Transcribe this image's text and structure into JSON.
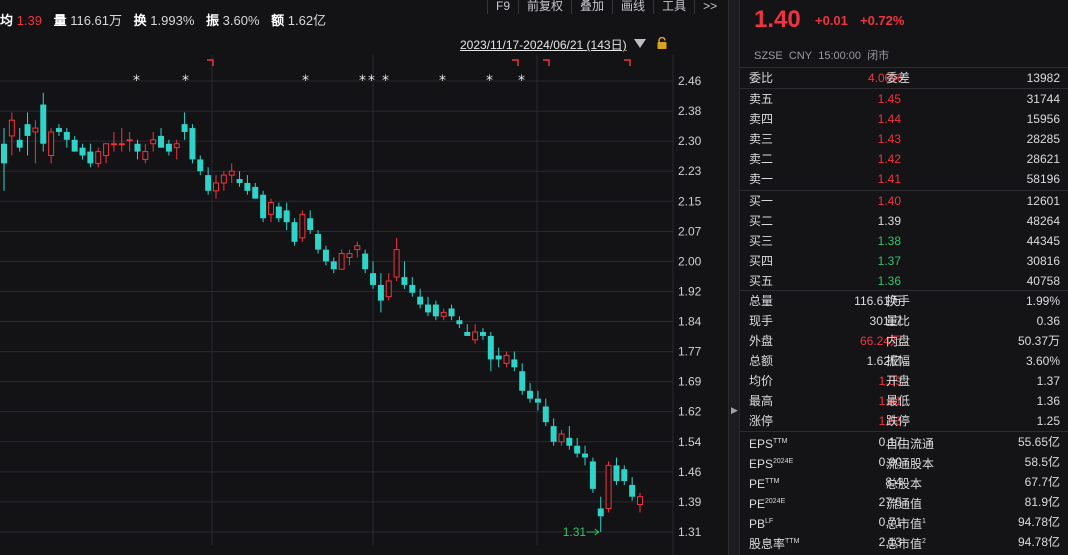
{
  "header": {
    "avg_label": "均",
    "avg_value": "1.39",
    "vol_label": "量",
    "vol_value": "116.61万",
    "turn_label": "换",
    "turn_value": "1.993%",
    "amp_label": "振",
    "amp_value": "3.60%",
    "amt_label": "额",
    "amt_value": "1.62亿"
  },
  "toolbar": [
    "F9",
    "前复权",
    "叠加",
    "画线",
    "工具",
    ">>"
  ],
  "date_range": "2023/11/17-2024/06/21 (143日)",
  "axis_labels": [
    "2.46",
    "2.38",
    "2.30",
    "2.23",
    "2.15",
    "2.07",
    "2.00",
    "1.92",
    "1.84",
    "1.77",
    "1.69",
    "1.62",
    "1.54",
    "1.46",
    "1.39",
    "1.31"
  ],
  "low_marker": "1.31",
  "colors": {
    "up": "#f0333f",
    "down": "#2fd3c8",
    "grid": "#2a2a2f"
  },
  "quote": {
    "price": "1.40",
    "change": "+0.01",
    "change_pct": "+0.72%",
    "exchange": "SZSE",
    "currency": "CNY",
    "time": "15:00:00",
    "status": "闭市"
  },
  "weibi": {
    "label1": "委比",
    "value1": "4.00%",
    "label2": "委差",
    "value2": "13982"
  },
  "asks": [
    {
      "label": "卖五",
      "price": "1.45",
      "volume": "31744"
    },
    {
      "label": "卖四",
      "price": "1.44",
      "volume": "15956"
    },
    {
      "label": "卖三",
      "price": "1.43",
      "volume": "28285"
    },
    {
      "label": "卖二",
      "price": "1.42",
      "volume": "28621"
    },
    {
      "label": "卖一",
      "price": "1.41",
      "volume": "58196"
    }
  ],
  "bids": [
    {
      "label": "买一",
      "price": "1.40",
      "volume": "12601"
    },
    {
      "label": "买二",
      "price": "1.39",
      "volume": "48264"
    },
    {
      "label": "买三",
      "price": "1.38",
      "volume": "44345"
    },
    {
      "label": "买四",
      "price": "1.37",
      "volume": "30816"
    },
    {
      "label": "买五",
      "price": "1.36",
      "volume": "40758"
    }
  ],
  "stats": [
    {
      "l1": "总量",
      "v1": "116.61万",
      "l2": "换手",
      "v2": "1.99%"
    },
    {
      "l1": "现手",
      "v1": "30117",
      "l2": "量比",
      "v2": "0.36"
    },
    {
      "l1": "外盘",
      "v1": "66.24万",
      "l2": "内盘",
      "v2": "50.37万"
    },
    {
      "l1": "总额",
      "v1": "1.62亿",
      "l2": "振幅",
      "v2": "3.60%"
    },
    {
      "l1": "均价",
      "v1": "1.39",
      "l2": "开盘",
      "v2": "1.37"
    },
    {
      "l1": "最高",
      "v1": "1.41",
      "l2": "最低",
      "v2": "1.36"
    },
    {
      "l1": "涨停",
      "v1": "1.53",
      "l2": "跌停",
      "v2": "1.25"
    }
  ],
  "fundamentals": [
    {
      "l1": "EPS",
      "s1": "TTM",
      "v1": "0.17",
      "l2": "自由流通",
      "s2": "",
      "v2": "55.65亿"
    },
    {
      "l1": "EPS",
      "s1": "2024E",
      "v1": "0.00",
      "l2": "流通股本",
      "s2": "",
      "v2": "58.5亿"
    },
    {
      "l1": "PE",
      "s1": "TTM",
      "v1": "8.4",
      "l2": "总股本",
      "s2": "",
      "v2": "67.7亿"
    },
    {
      "l1": "PE",
      "s1": "2024E",
      "v1": "27.5",
      "l2": "流通值",
      "s2": "",
      "v2": "81.9亿"
    },
    {
      "l1": "PB",
      "s1": "LF",
      "v1": "0.71",
      "l2": "总市值",
      "s2": "1",
      "v2": "94.78亿"
    },
    {
      "l1": "股息率",
      "s1": "TTM",
      "v1": "2.13",
      "l2": "总市值",
      "s2": "2",
      "v2": "94.78亿"
    }
  ],
  "candles": [
    [
      2.3,
      2.34,
      2.18,
      2.25
    ],
    [
      2.32,
      2.38,
      2.27,
      2.36
    ],
    [
      2.31,
      2.34,
      2.28,
      2.29
    ],
    [
      2.35,
      2.38,
      2.27,
      2.32
    ],
    [
      2.33,
      2.36,
      2.25,
      2.34
    ],
    [
      2.4,
      2.43,
      2.28,
      2.3
    ],
    [
      2.27,
      2.34,
      2.25,
      2.33
    ],
    [
      2.34,
      2.35,
      2.32,
      2.33
    ],
    [
      2.33,
      2.34,
      2.29,
      2.31
    ],
    [
      2.31,
      2.32,
      2.28,
      2.28
    ],
    [
      2.29,
      2.3,
      2.26,
      2.27
    ],
    [
      2.28,
      2.3,
      2.24,
      2.25
    ],
    [
      2.25,
      2.29,
      2.24,
      2.28
    ],
    [
      2.27,
      2.3,
      2.25,
      2.3
    ],
    [
      2.3,
      2.33,
      2.28,
      2.3
    ],
    [
      2.3,
      2.34,
      2.28,
      2.3
    ],
    [
      2.31,
      2.33,
      2.28,
      2.31
    ],
    [
      2.3,
      2.31,
      2.26,
      2.28
    ],
    [
      2.26,
      2.3,
      2.25,
      2.28
    ],
    [
      2.3,
      2.33,
      2.28,
      2.31
    ],
    [
      2.32,
      2.34,
      2.29,
      2.29
    ],
    [
      2.3,
      2.31,
      2.27,
      2.28
    ],
    [
      2.29,
      2.31,
      2.26,
      2.3
    ],
    [
      2.35,
      2.38,
      2.31,
      2.33
    ],
    [
      2.34,
      2.35,
      2.25,
      2.26
    ],
    [
      2.26,
      2.27,
      2.22,
      2.23
    ],
    [
      2.22,
      2.24,
      2.17,
      2.18
    ],
    [
      2.18,
      2.22,
      2.16,
      2.2
    ],
    [
      2.2,
      2.23,
      2.18,
      2.22
    ],
    [
      2.22,
      2.25,
      2.2,
      2.23
    ],
    [
      2.21,
      2.23,
      2.19,
      2.2
    ],
    [
      2.2,
      2.22,
      2.17,
      2.18
    ],
    [
      2.19,
      2.2,
      2.16,
      2.16
    ],
    [
      2.17,
      2.18,
      2.1,
      2.11
    ],
    [
      2.12,
      2.16,
      2.1,
      2.15
    ],
    [
      2.14,
      2.15,
      2.1,
      2.11
    ],
    [
      2.13,
      2.15,
      2.08,
      2.1
    ],
    [
      2.1,
      2.11,
      2.04,
      2.05
    ],
    [
      2.06,
      2.13,
      2.05,
      2.12
    ],
    [
      2.11,
      2.13,
      2.07,
      2.08
    ],
    [
      2.07,
      2.08,
      2.02,
      2.03
    ],
    [
      2.03,
      2.04,
      1.99,
      2.0
    ],
    [
      2.0,
      2.01,
      1.97,
      1.98
    ],
    [
      1.98,
      2.03,
      1.98,
      2.02
    ],
    [
      2.01,
      2.03,
      1.99,
      2.02
    ],
    [
      2.03,
      2.05,
      2.01,
      2.04
    ],
    [
      2.02,
      2.03,
      1.97,
      1.98
    ],
    [
      1.97,
      2.0,
      1.93,
      1.94
    ],
    [
      1.94,
      1.97,
      1.87,
      1.9
    ],
    [
      1.91,
      1.97,
      1.9,
      1.95
    ],
    [
      1.96,
      2.06,
      1.95,
      2.03
    ],
    [
      1.96,
      2.0,
      1.93,
      1.94
    ],
    [
      1.94,
      1.96,
      1.91,
      1.92
    ],
    [
      1.91,
      1.93,
      1.88,
      1.89
    ],
    [
      1.89,
      1.91,
      1.86,
      1.87
    ],
    [
      1.89,
      1.9,
      1.85,
      1.86
    ],
    [
      1.86,
      1.88,
      1.85,
      1.87
    ],
    [
      1.88,
      1.89,
      1.85,
      1.86
    ],
    [
      1.85,
      1.86,
      1.83,
      1.84
    ],
    [
      1.82,
      1.84,
      1.81,
      1.81
    ],
    [
      1.8,
      1.84,
      1.79,
      1.82
    ],
    [
      1.82,
      1.83,
      1.8,
      1.81
    ],
    [
      1.81,
      1.82,
      1.72,
      1.75
    ],
    [
      1.76,
      1.78,
      1.73,
      1.75
    ],
    [
      1.74,
      1.77,
      1.73,
      1.76
    ],
    [
      1.75,
      1.77,
      1.72,
      1.73
    ],
    [
      1.72,
      1.74,
      1.66,
      1.67
    ],
    [
      1.67,
      1.69,
      1.64,
      1.65
    ],
    [
      1.65,
      1.67,
      1.62,
      1.64
    ],
    [
      1.63,
      1.65,
      1.58,
      1.59
    ],
    [
      1.58,
      1.6,
      1.53,
      1.54
    ],
    [
      1.54,
      1.57,
      1.53,
      1.56
    ],
    [
      1.55,
      1.58,
      1.52,
      1.53
    ],
    [
      1.53,
      1.55,
      1.5,
      1.51
    ],
    [
      1.51,
      1.53,
      1.48,
      1.5
    ],
    [
      1.49,
      1.5,
      1.41,
      1.42
    ],
    [
      1.37,
      1.4,
      1.31,
      1.35
    ],
    [
      1.37,
      1.49,
      1.36,
      1.48
    ],
    [
      1.48,
      1.5,
      1.43,
      1.44
    ],
    [
      1.47,
      1.48,
      1.43,
      1.44
    ],
    [
      1.43,
      1.45,
      1.39,
      1.4
    ],
    [
      1.38,
      1.41,
      1.36,
      1.4
    ]
  ],
  "star_markers": [
    137,
    186,
    306,
    363,
    372,
    386,
    443,
    490,
    522
  ],
  "flag_markers": [
    211,
    516,
    547,
    628
  ]
}
